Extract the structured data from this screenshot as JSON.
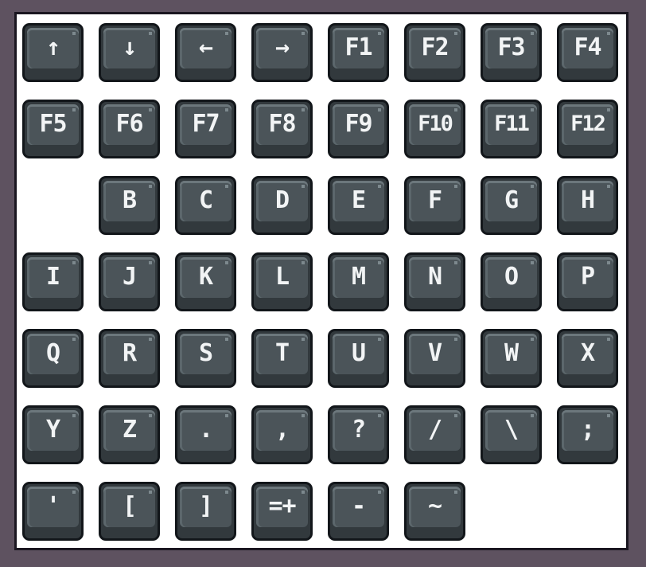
{
  "rows": [
    [
      "↑",
      "↓",
      "←",
      "→",
      "F1",
      "F2",
      "F3",
      "F4"
    ],
    [
      "F5",
      "F6",
      "F7",
      "F8",
      "F9",
      "F10",
      "F11",
      "F12"
    ],
    [
      "",
      "B",
      "C",
      "D",
      "E",
      "F",
      "G",
      "H"
    ],
    [
      "I",
      "J",
      "K",
      "L",
      "M",
      "N",
      "O",
      "P"
    ],
    [
      "Q",
      "R",
      "S",
      "T",
      "U",
      "V",
      "W",
      "X"
    ],
    [
      "Y",
      "Z",
      ".",
      ",",
      "?",
      "/",
      "\\",
      ";"
    ],
    [
      "'",
      "[",
      "]",
      "=+",
      "-",
      "~"
    ]
  ],
  "colors": {
    "frame": "#5e5260",
    "sheet": "#ffffff",
    "key_top": "#4b5459",
    "key_side": "#32393d",
    "key_outline": "#12161a",
    "label": "#f2f4f5"
  }
}
